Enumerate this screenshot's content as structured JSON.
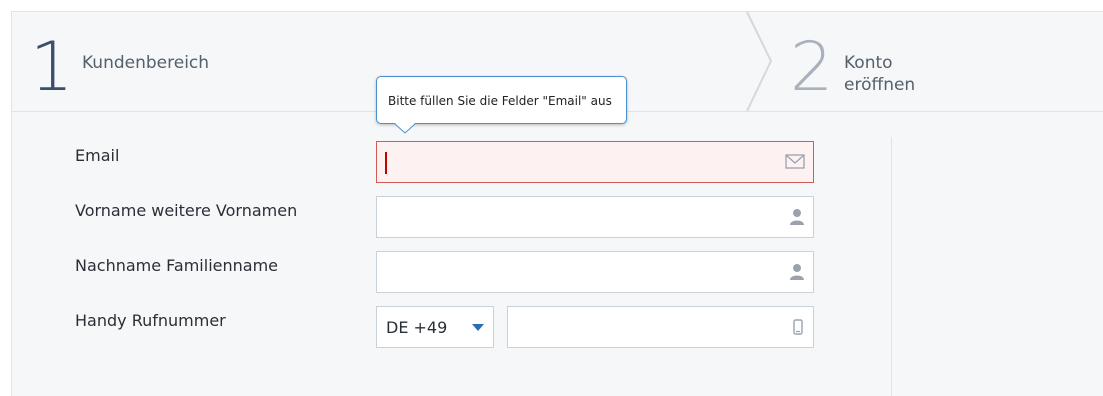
{
  "steps": [
    {
      "number": "1",
      "label": "Kundenbereich"
    },
    {
      "number": "2",
      "label": "Konto eröffnen"
    }
  ],
  "tooltip": {
    "text": "Bitte füllen Sie die Felder \"Email\" aus"
  },
  "form": {
    "email_label": "Email",
    "firstname_label": "Vorname weitere Vornamen",
    "lastname_label": "Nachname Familienname",
    "phone_label": "Handy Rufnummer",
    "country_code": "DE +49"
  },
  "colors": {
    "error_border": "#d45a5a",
    "error_bg": "#fdf1f1",
    "tooltip_border": "#4a8fd0",
    "dropdown_arrow": "#2a6db5"
  },
  "icons": [
    "envelope-icon",
    "user-icon",
    "user-icon",
    "mobile-phone-icon",
    "caret-down-icon"
  ]
}
